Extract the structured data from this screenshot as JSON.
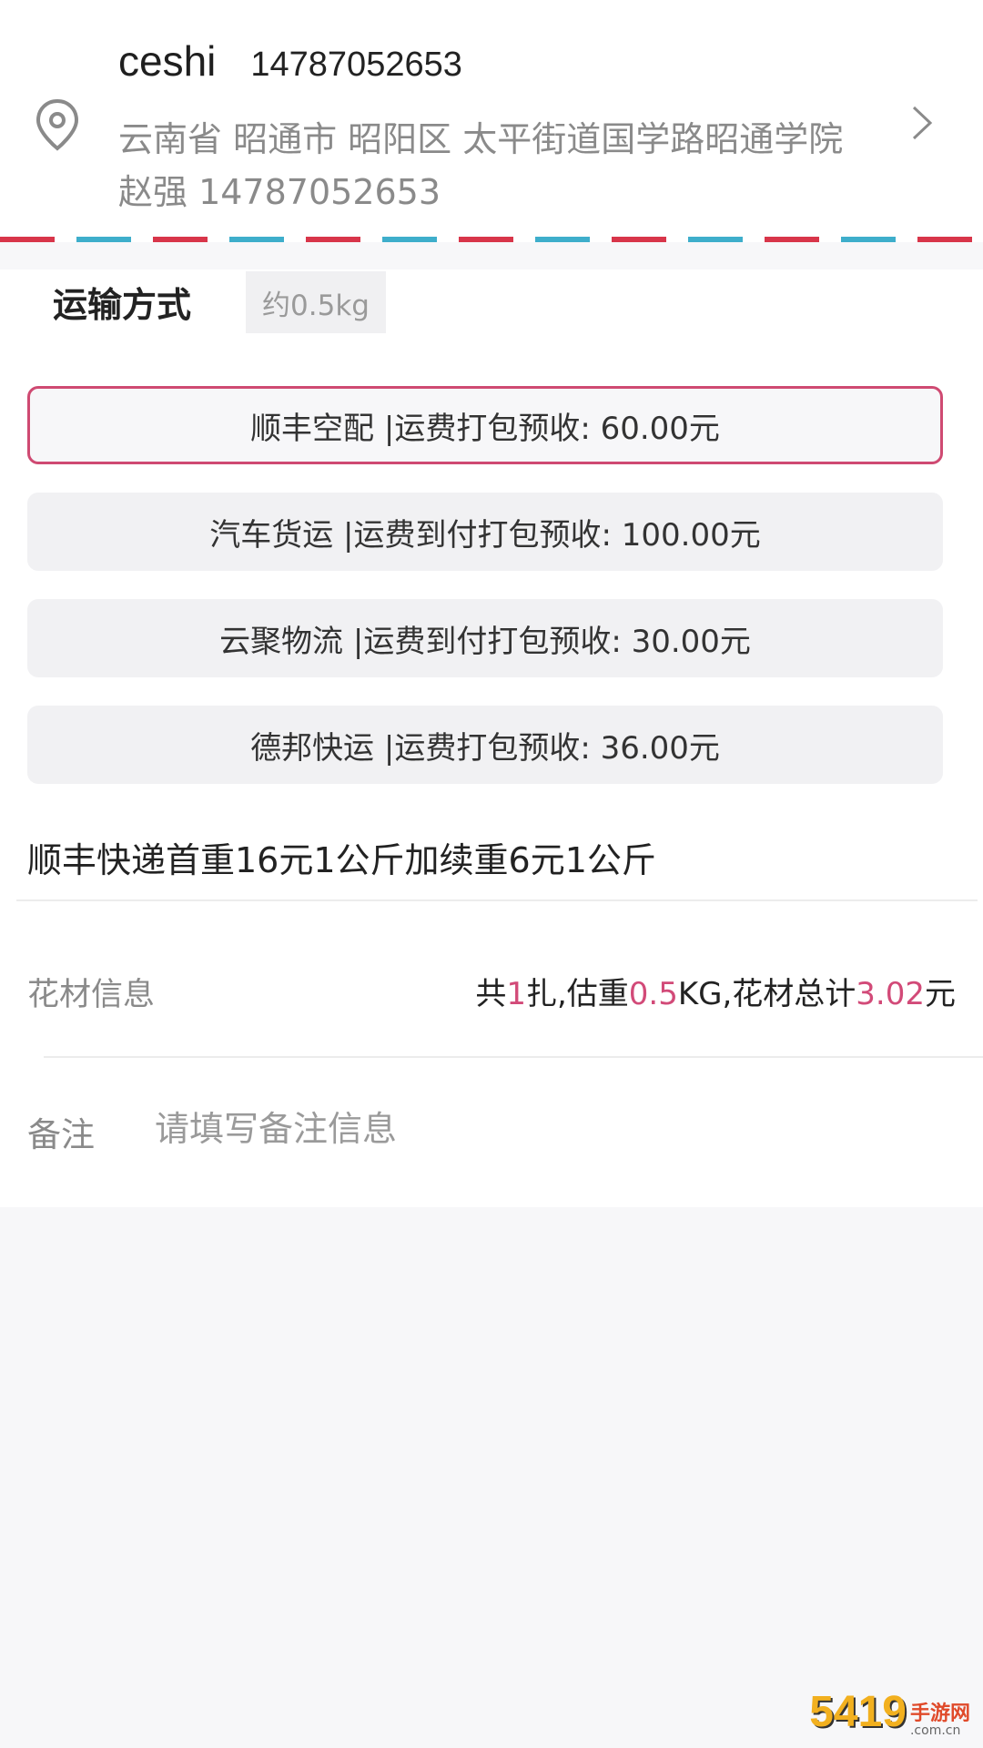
{
  "address": {
    "name": "ceshi",
    "phone": "14787052653",
    "line1": "云南省 昭通市 昭阳区 太平街道国学路昭通学院",
    "line2": "赵强 14787052653",
    "location_icon": "location-pin-icon",
    "chevron_icon": "chevron-right-icon"
  },
  "shipping": {
    "title": "运输方式",
    "weight_badge": "约0.5kg",
    "options": [
      {
        "label": "顺丰空配 |运费打包预收: 60.00元",
        "selected": true
      },
      {
        "label": "汽车货运 |运费到付打包预收: 100.00元",
        "selected": false
      },
      {
        "label": "云聚物流 |运费到付打包预收: 30.00元",
        "selected": false
      },
      {
        "label": "德邦快运 |运费打包预收: 36.00元",
        "selected": false
      }
    ],
    "note": "顺丰快递首重16元1公斤加续重6元1公斤",
    "accent_color": "#cf4a72"
  },
  "flower_info": {
    "label": "花材信息",
    "summary": {
      "prefix": "共",
      "count": "1",
      "mid1": "扎,估重",
      "weight": "0.5",
      "mid2": "KG,花材总计",
      "total": "3.02",
      "suffix": "元"
    },
    "highlight_color": "#d24a78"
  },
  "remark": {
    "label": "备注",
    "placeholder": "请填写备注信息"
  },
  "watermark": {
    "main": "5419",
    "sub1": "手游网",
    "sub2": ".com.cn"
  }
}
